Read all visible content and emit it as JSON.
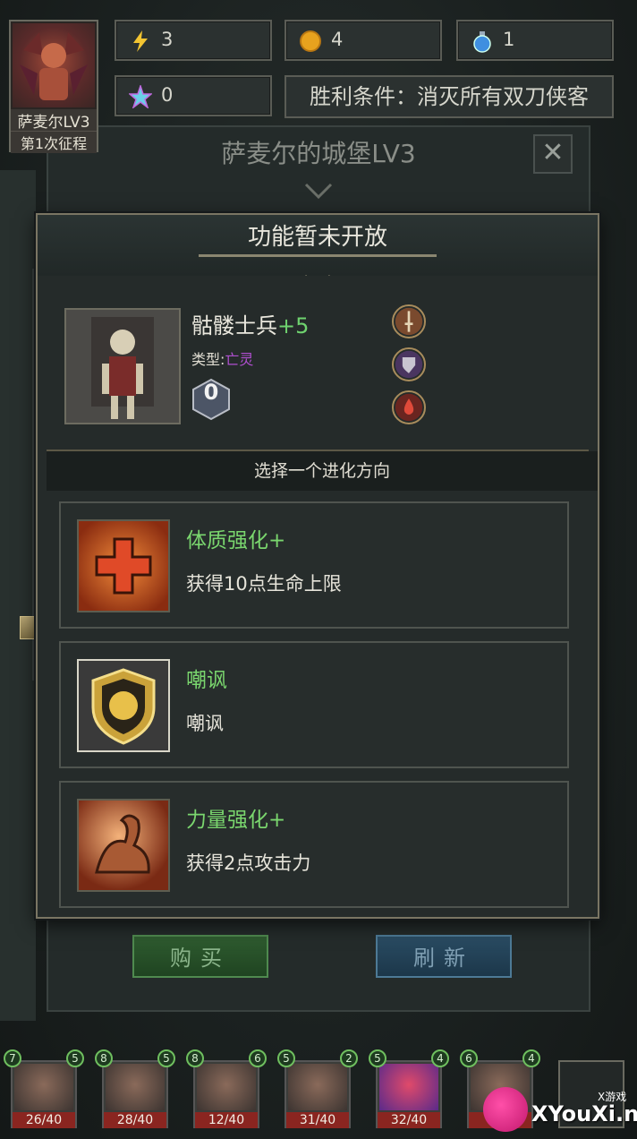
{
  "hud": {
    "hero_name": "萨麦尔LV3",
    "expedition": "第1次征程",
    "energy": "3",
    "gold": "4",
    "potion": "1",
    "gems": "0",
    "victory": "胜利条件：消灭所有双刀侠客"
  },
  "background": {
    "castle_title": "萨麦尔的城堡LV3",
    "close_glyph": "✕",
    "buy_label": "购买",
    "refresh_label": "刷新"
  },
  "dialog": {
    "title": "功能暂未开放",
    "unit": {
      "name": "骷髅士兵",
      "plus": "+5",
      "type_label": "类型:",
      "type_value": "亡灵",
      "count": "0"
    },
    "choose_label": "选择一个进化方向",
    "options": [
      {
        "title": "体质强化+",
        "desc": "获得10点生命上限",
        "icon": "cross-icon"
      },
      {
        "title": "嘲讽",
        "desc": "嘲讽",
        "icon": "lion-shield-icon"
      },
      {
        "title": "力量强化+",
        "desc": "获得2点攻击力",
        "icon": "flexed-arm-icon"
      }
    ]
  },
  "roster": [
    {
      "left": "7",
      "right": "5",
      "hp": "26/40"
    },
    {
      "left": "8",
      "right": "5",
      "hp": "28/40"
    },
    {
      "left": "8",
      "right": "6",
      "hp": "12/40"
    },
    {
      "left": "5",
      "right": "2",
      "hp": "31/40"
    },
    {
      "left": "5",
      "right": "4",
      "hp": "32/40"
    },
    {
      "left": "6",
      "right": "4",
      "hp": "3"
    }
  ],
  "watermark": {
    "text": "XYouXi.net",
    "small": "X游戏"
  },
  "colors": {
    "green_text": "#7ad66e",
    "purple_type": "#b04fd0",
    "gold_border": "#7a7563"
  }
}
